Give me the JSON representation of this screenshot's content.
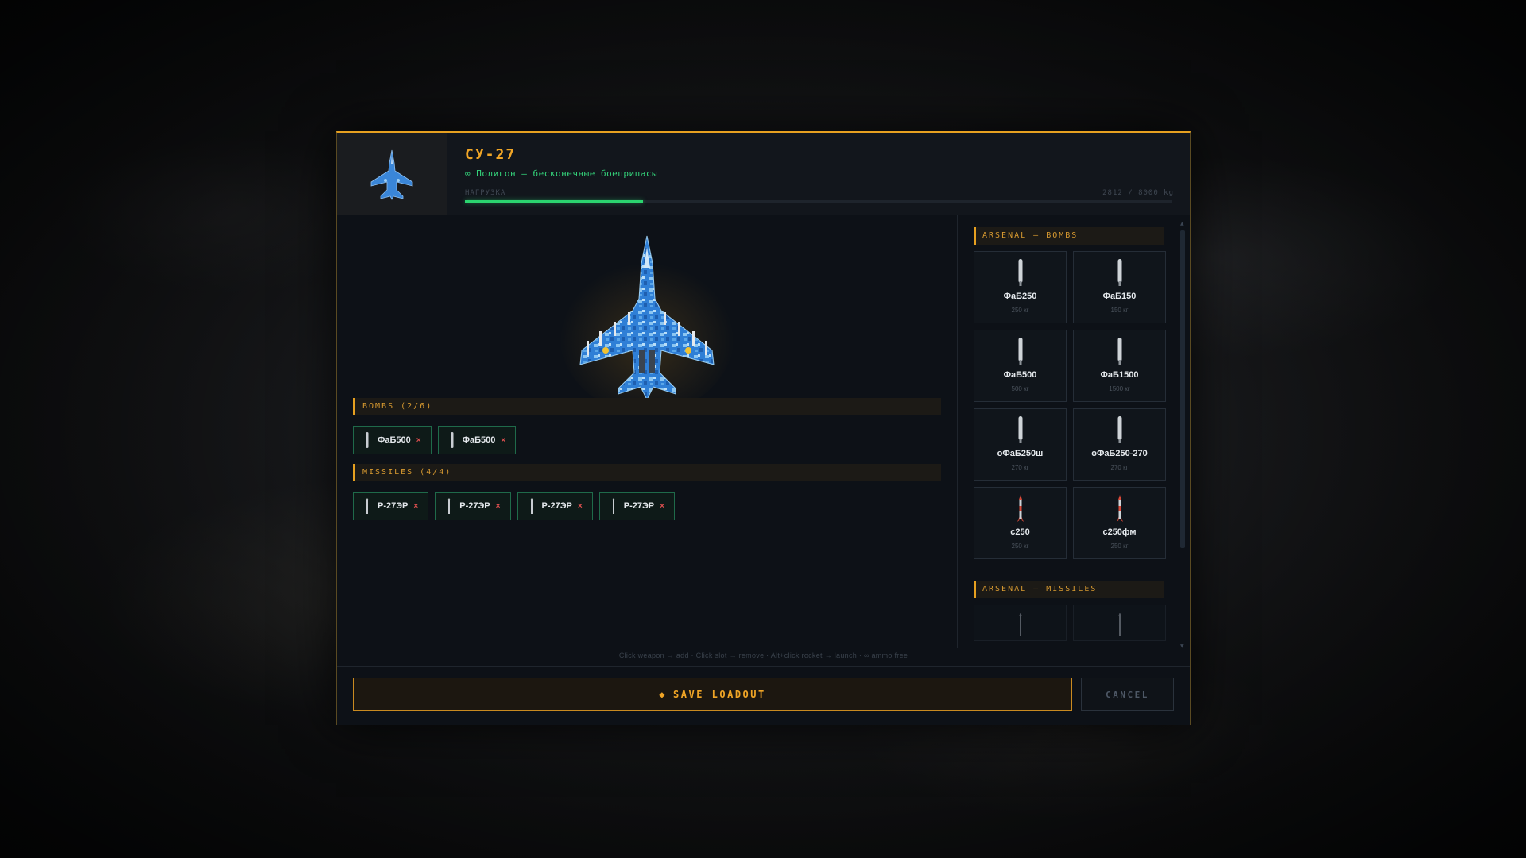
{
  "header": {
    "aircraft_name": "СУ-27",
    "mode": "∞ Полигон – бесконечные боеприпасы",
    "load_label": "НАГРУЗКА",
    "load_value": "2812 / 8000 kg",
    "load_fraction": 0.2515
  },
  "loadout": {
    "bombs_title": "BOMBS (2/6)",
    "bombs": [
      {
        "label": "ФаБ500",
        "remove": "×"
      },
      {
        "label": "ФаБ500",
        "remove": "×"
      }
    ],
    "missiles_title": "MISSILES (4/4)",
    "missiles": [
      {
        "label": "Р-27ЭР",
        "remove": "×"
      },
      {
        "label": "Р-27ЭР",
        "remove": "×"
      },
      {
        "label": "Р-27ЭР",
        "remove": "×"
      },
      {
        "label": "Р-27ЭР",
        "remove": "×"
      }
    ]
  },
  "arsenal": {
    "bombs_title": "ARSENAL – BOMBS",
    "bombs": [
      {
        "name": "ФаБ250",
        "weight": "250 кг",
        "icon": "bomb-icon"
      },
      {
        "name": "ФаБ150",
        "weight": "150 кг",
        "icon": "bomb-icon"
      },
      {
        "name": "ФаБ500",
        "weight": "500 кг",
        "icon": "bomb-icon"
      },
      {
        "name": "ФаБ1500",
        "weight": "1500 кг",
        "icon": "bomb-icon"
      },
      {
        "name": "оФаБ250ш",
        "weight": "270 кг",
        "icon": "bomb-icon"
      },
      {
        "name": "оФаБ250-270",
        "weight": "270 кг",
        "icon": "bomb-icon"
      },
      {
        "name": "с250",
        "weight": "250 кг",
        "icon": "rocket-icon"
      },
      {
        "name": "с250фм",
        "weight": "250 кг",
        "icon": "rocket-icon"
      }
    ],
    "missiles_title": "ARSENAL – MISSILES"
  },
  "hint": "Click weapon → add · Click slot → remove · Alt+click rocket → launch · ∞ ammo free",
  "footer": {
    "save_icon": "◆",
    "save_label": "SAVE LOADOUT",
    "cancel_label": "CANCEL"
  },
  "colors": {
    "accent": "#e6a020",
    "load_bar": "#2bd46f",
    "chip_border": "#1f6a4a",
    "remove": "#e05050"
  }
}
